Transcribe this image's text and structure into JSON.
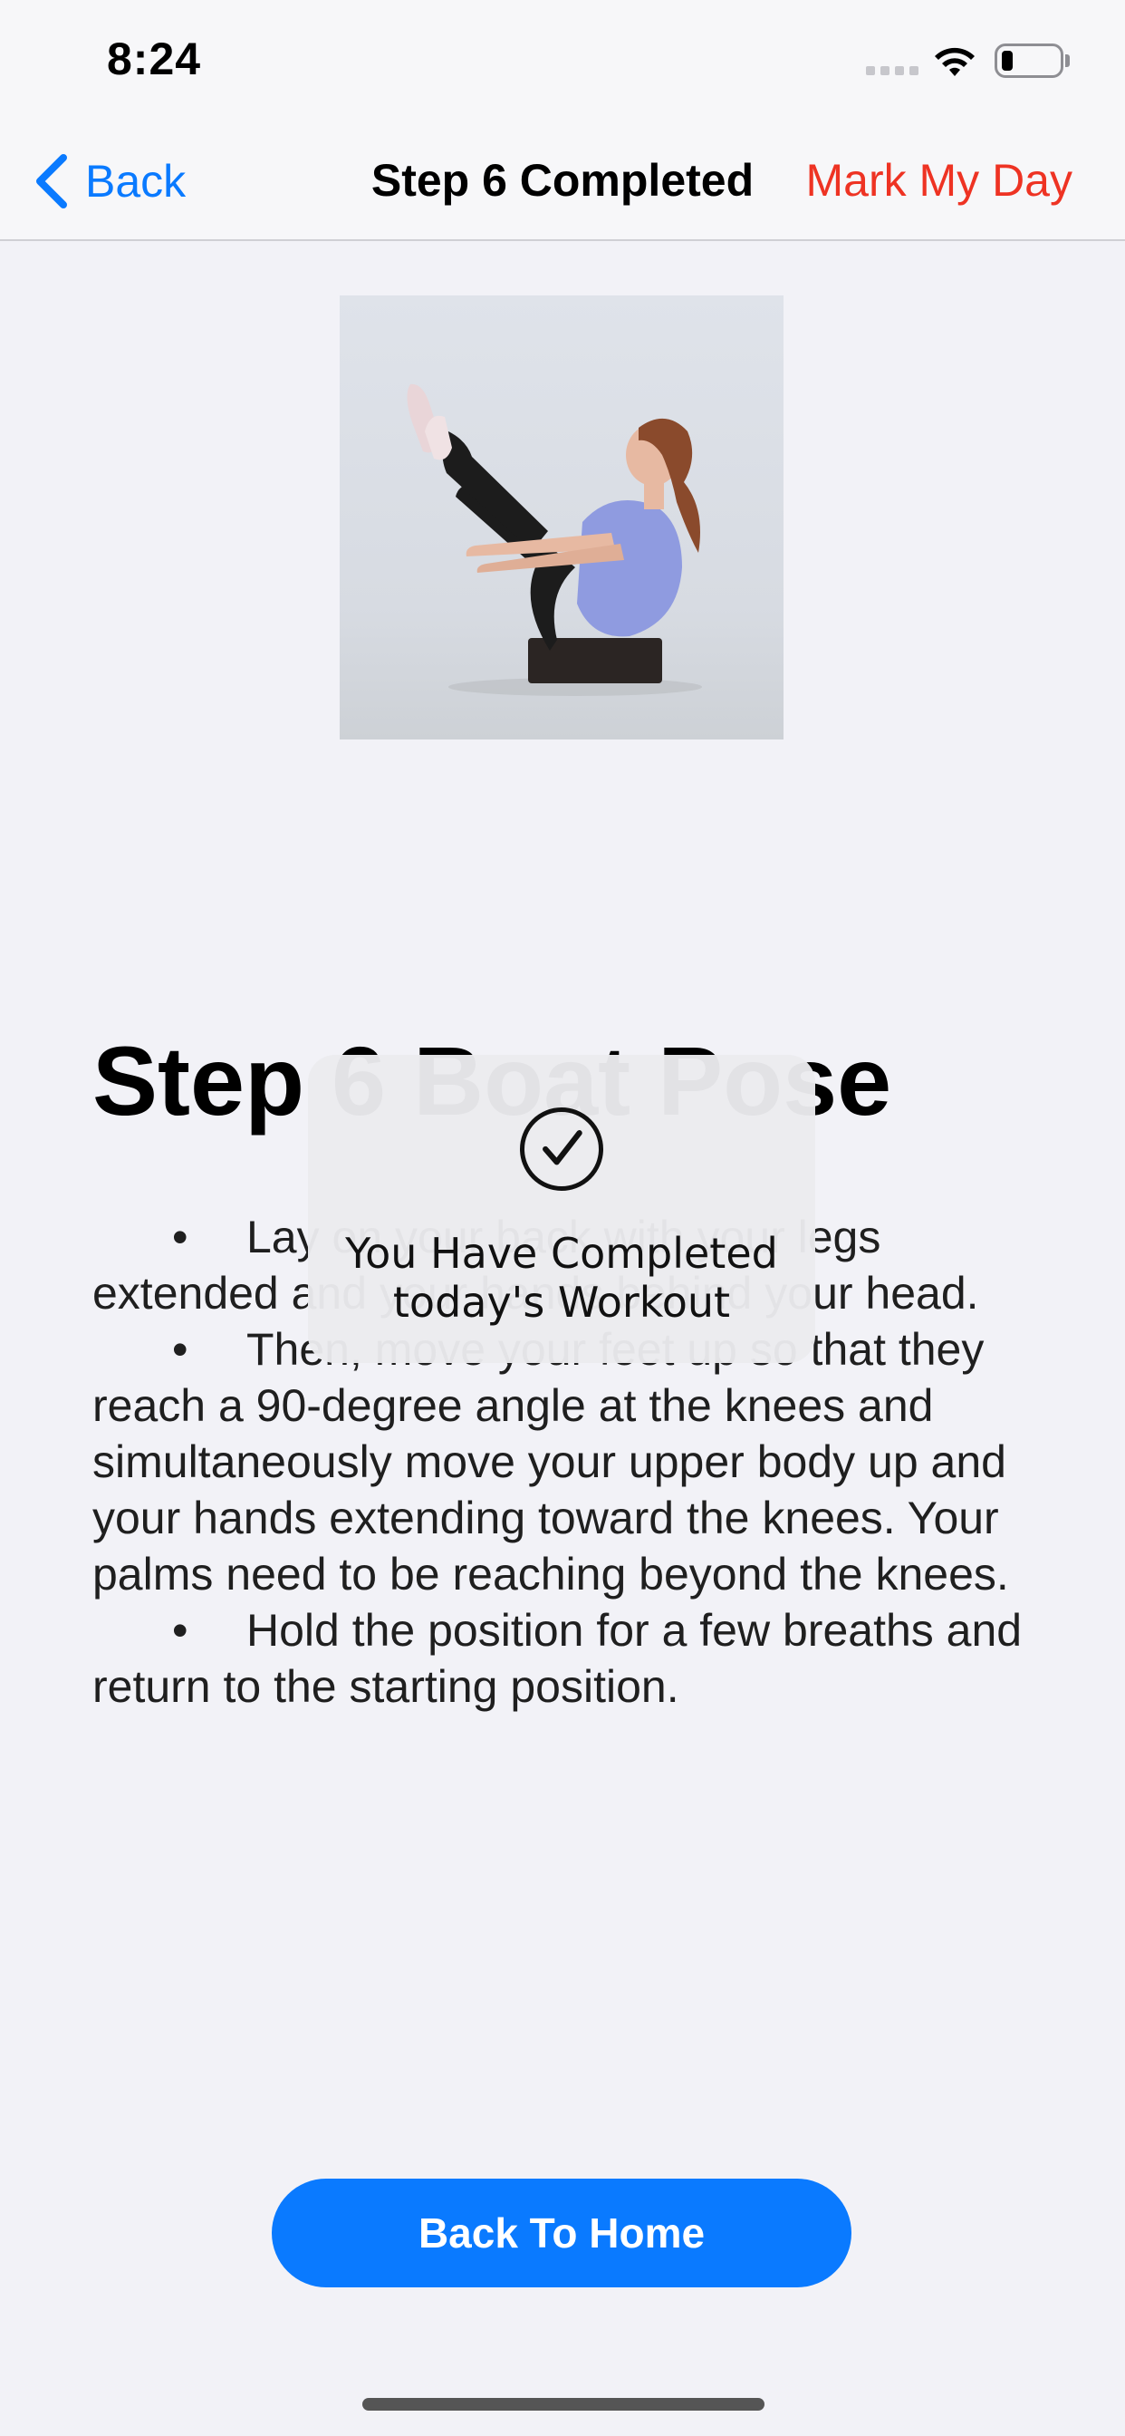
{
  "status_bar": {
    "time": "8:24"
  },
  "nav": {
    "back_label": "Back",
    "title": "Step 6 Completed",
    "action_label": "Mark My Day"
  },
  "exercise": {
    "title": "Step 6 Boat Pose",
    "instructions": [
      "Lay on your back with your legs extended and your hands behind your head.",
      "Then, move your feet up so that they reach a 90-degree angle at the knees and simultaneously move your upper body up and your hands extending toward the knees. Your palms need to be reaching beyond the knees.",
      "Hold the position for a few breaths and return to the starting position."
    ]
  },
  "hud": {
    "message": "You Have Completed today's Workout"
  },
  "footer": {
    "home_button_label": "Back To Home"
  },
  "colors": {
    "accent_blue": "#0a7aff",
    "accent_red": "#ee3323",
    "background": "#f2f2f7"
  }
}
